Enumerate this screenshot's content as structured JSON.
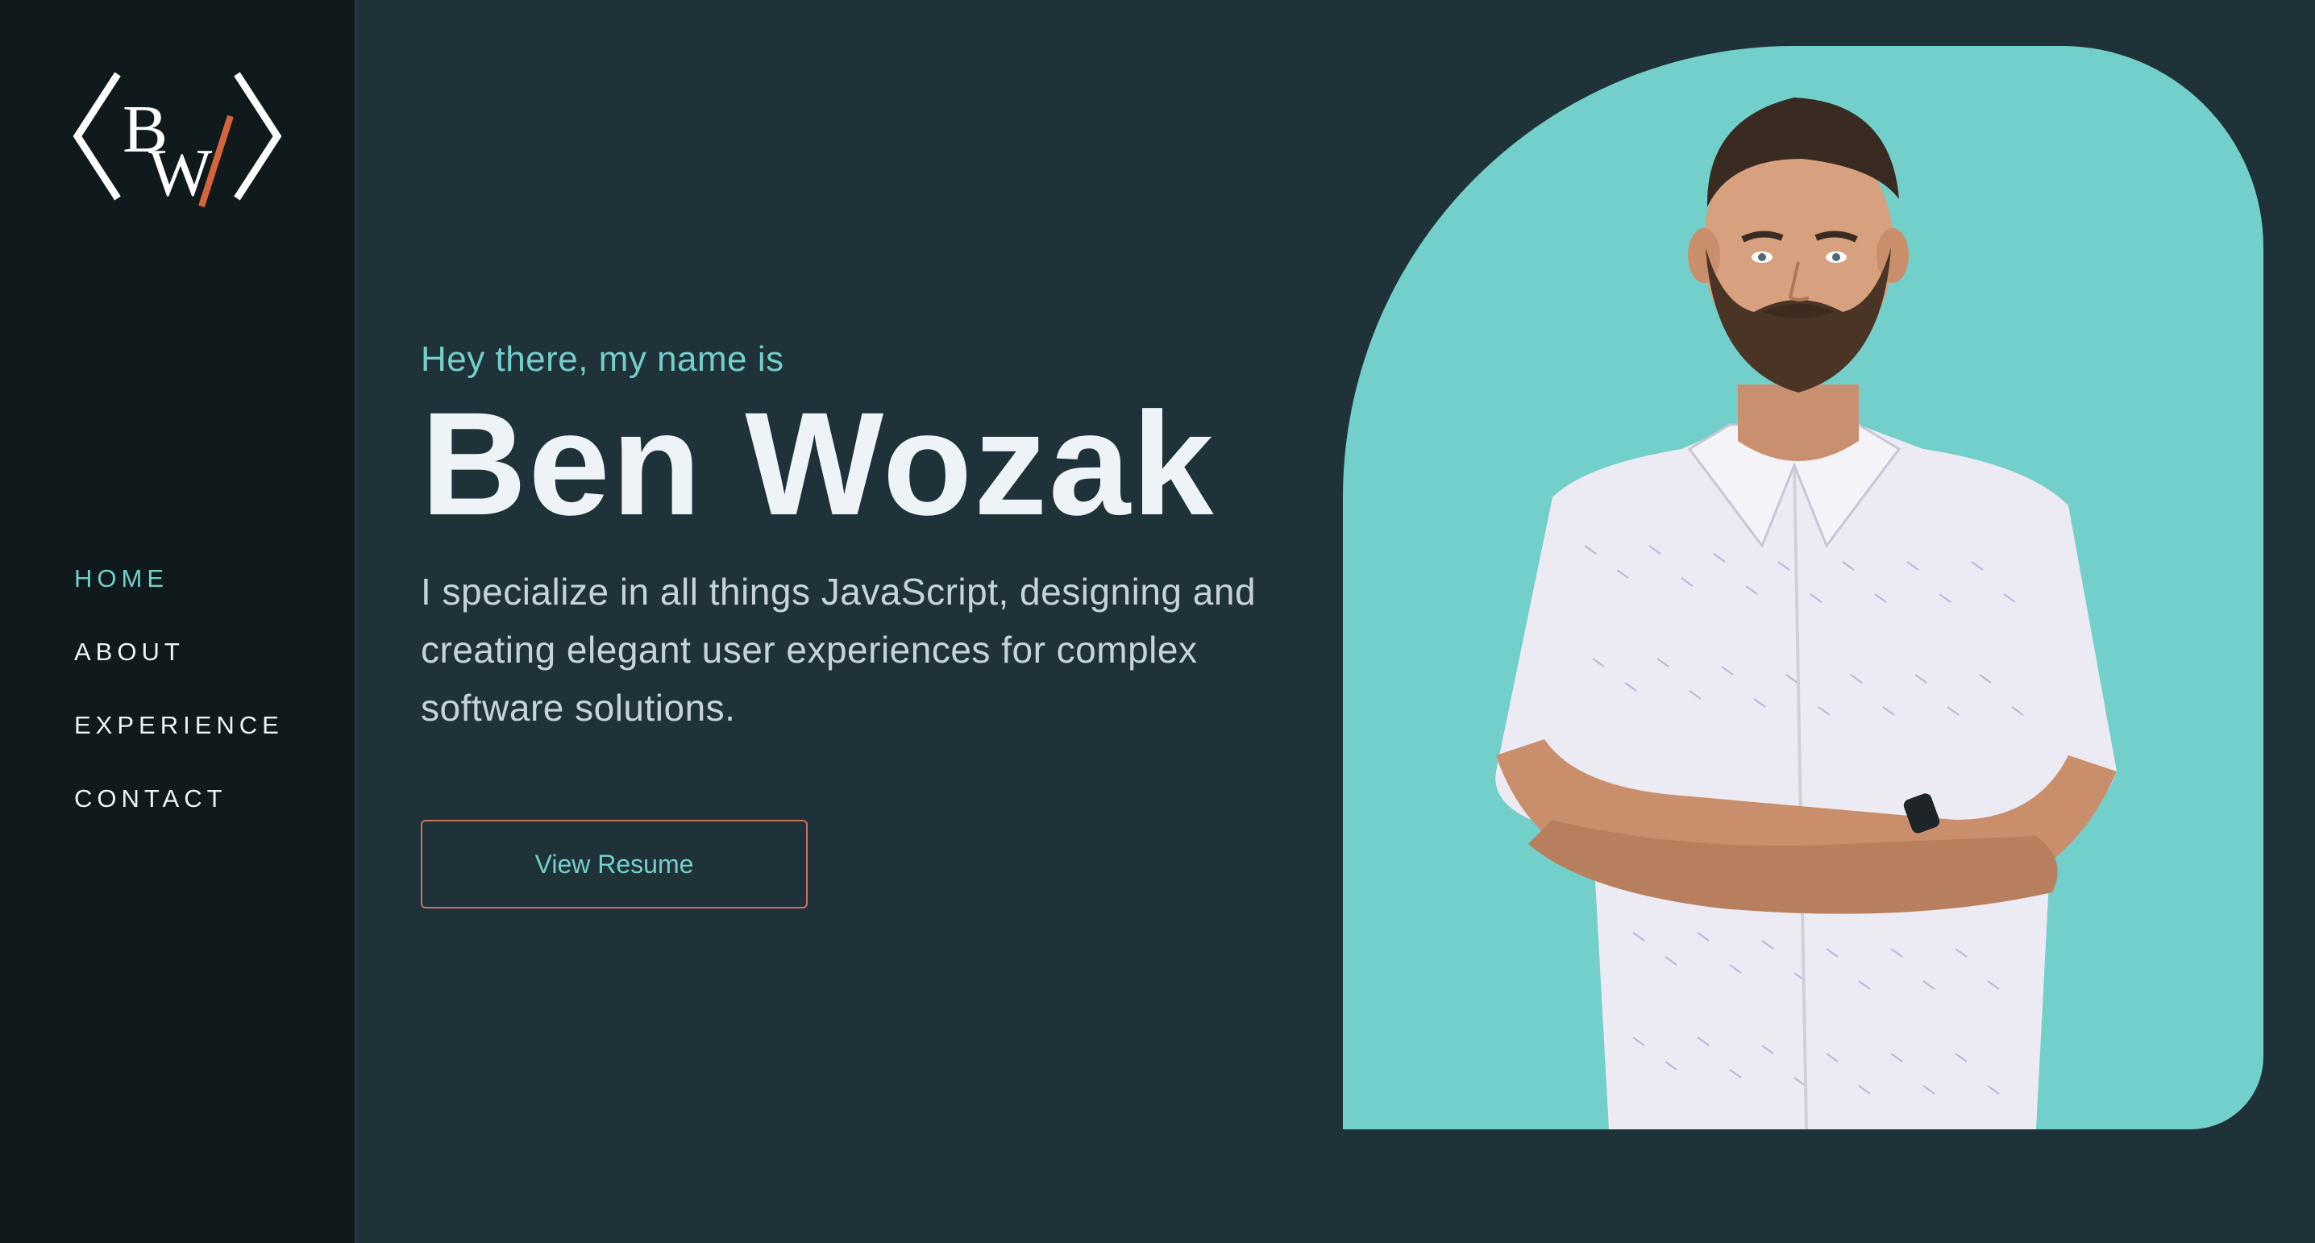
{
  "logo": {
    "letters": "BW",
    "accent_color": "#d4643c",
    "icon": "bw-monogram-logo"
  },
  "nav": {
    "items": [
      {
        "label": "HOME",
        "active": true
      },
      {
        "label": "ABOUT",
        "active": false
      },
      {
        "label": "EXPERIENCE",
        "active": false
      },
      {
        "label": "CONTACT",
        "active": false
      }
    ]
  },
  "hero": {
    "greeting": "Hey there, my name is",
    "name": "Ben Wozak",
    "tagline": "I specialize in all things JavaScript, designing and creating elegant user experiences for complex software solutions.",
    "resume_button": "View Resume"
  },
  "colors": {
    "background": "#1f3239",
    "sidebar": "#101a1d",
    "accent": "#73cfc9",
    "button_border": "#c9735a",
    "heading": "#eef3f7"
  },
  "portrait": {
    "icon": "profile-photo"
  }
}
